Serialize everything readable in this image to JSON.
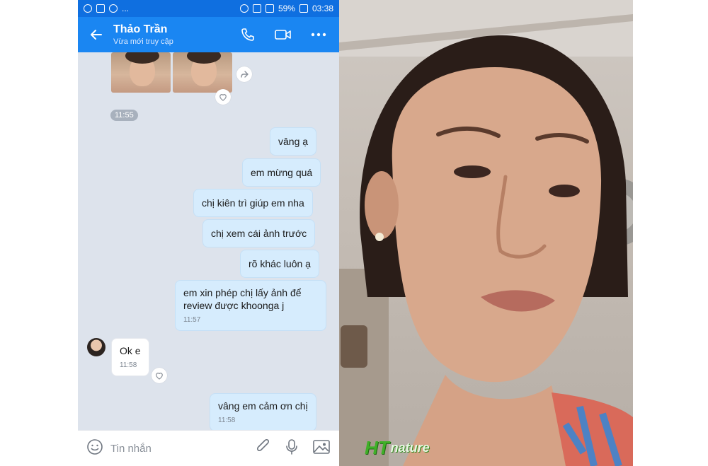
{
  "status_bar": {
    "battery": "59%",
    "time": "03:38",
    "overflow": "..."
  },
  "header": {
    "title": "Thảo Trần",
    "subtitle": "Vừa mới truy cập"
  },
  "chat": {
    "time_separator": "11:55",
    "outgoing": [
      {
        "text": "vâng ạ"
      },
      {
        "text": "em mừng quá"
      },
      {
        "text": "chị kiên trì giúp em nha"
      },
      {
        "text": "chị xem cái ảnh trước"
      },
      {
        "text": "rõ khác luôn ạ"
      },
      {
        "text": "em xin phép chị lấy ảnh để review được khoonga j",
        "time": "11:57"
      }
    ],
    "incoming": {
      "text": "Ok e",
      "time": "11:58"
    },
    "last_outgoing": {
      "text": "vâng em cảm ơn chị",
      "time": "11:58"
    }
  },
  "composer": {
    "placeholder": "Tin nhắn"
  },
  "logo": {
    "brand_ht": "HT",
    "brand_nature": "nature"
  },
  "colors": {
    "header_blue": "#1a86f2",
    "status_blue": "#0f6fe0",
    "bubble_out": "#d6ecfd",
    "chat_bg": "#dde3ec",
    "logo_green": "#3fb028"
  },
  "icons": [
    "back-arrow-icon",
    "phone-icon",
    "video-call-icon",
    "more-icon",
    "heart-icon",
    "share-icon",
    "emoji-icon",
    "attachment-icon",
    "microphone-icon",
    "image-icon"
  ]
}
